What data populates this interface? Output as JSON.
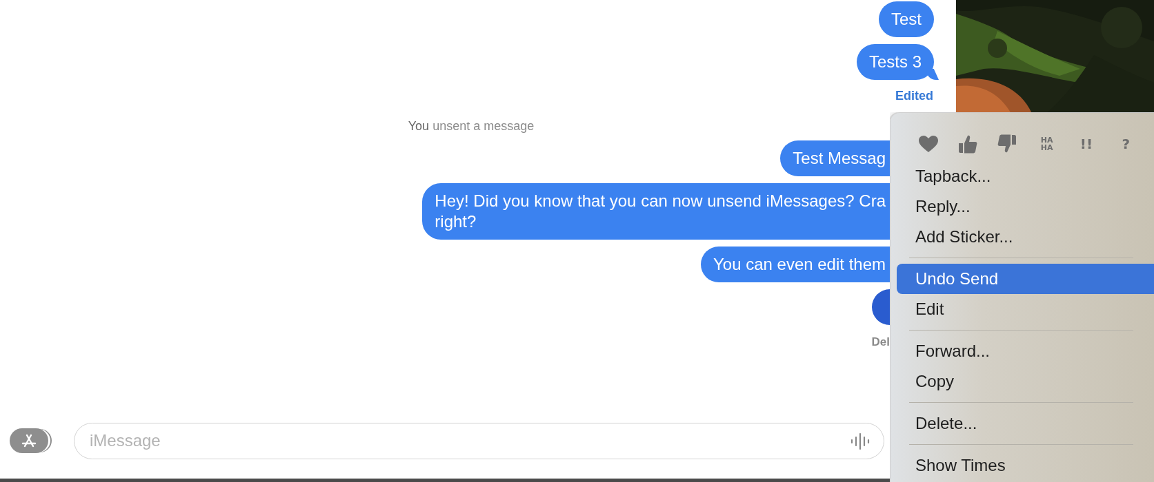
{
  "conversation": [
    {
      "kind": "bubble",
      "text": "Test",
      "tail": false,
      "selected": false,
      "covered": false
    },
    {
      "kind": "bubble",
      "text": "Tests 3",
      "tail": true,
      "selected": false,
      "covered": false
    },
    {
      "kind": "edited",
      "text": "Edited"
    },
    {
      "kind": "notice",
      "text": "**You** unsent a message"
    },
    {
      "kind": "bubble",
      "text": "Test Messag",
      "tail": false,
      "selected": false,
      "covered": true
    },
    {
      "kind": "bubble",
      "lines": [
        "Hey! Did you know that you can now unsend iMessages? Cra",
        "right?"
      ],
      "tail": false,
      "selected": false,
      "covered": true
    },
    {
      "kind": "bubble",
      "text": "You can even edit them",
      "tail": false,
      "selected": false,
      "covered": true
    },
    {
      "kind": "bubble",
      "tail": false,
      "selected": true,
      "covered": true
    },
    {
      "kind": "status",
      "text": "Del"
    }
  ],
  "compose": {
    "placeholder": "iMessage"
  },
  "context_menu": {
    "tapbacks": [
      {
        "kind": "heart"
      },
      {
        "kind": "like"
      },
      {
        "kind": "dislike"
      },
      {
        "kind": "text",
        "text": "HA HA"
      },
      {
        "kind": "text",
        "text": "!!"
      },
      {
        "kind": "text",
        "text": "?"
      }
    ],
    "items": [
      {
        "kind": "item",
        "label": "Tapback...",
        "selected": false
      },
      {
        "kind": "item",
        "label": "Reply...",
        "selected": false
      },
      {
        "kind": "item",
        "label": "Add Sticker...",
        "selected": false
      },
      {
        "kind": "separator"
      },
      {
        "kind": "item",
        "label": "Undo Send",
        "selected": true
      },
      {
        "kind": "item",
        "label": "Edit",
        "selected": false
      },
      {
        "kind": "separator"
      },
      {
        "kind": "item",
        "label": "Forward...",
        "selected": false
      },
      {
        "kind": "item",
        "label": "Copy",
        "selected": false
      },
      {
        "kind": "separator"
      },
      {
        "kind": "item",
        "label": "Delete...",
        "selected": false
      },
      {
        "kind": "separator"
      },
      {
        "kind": "item",
        "label": "Show Times",
        "selected": false
      }
    ]
  }
}
